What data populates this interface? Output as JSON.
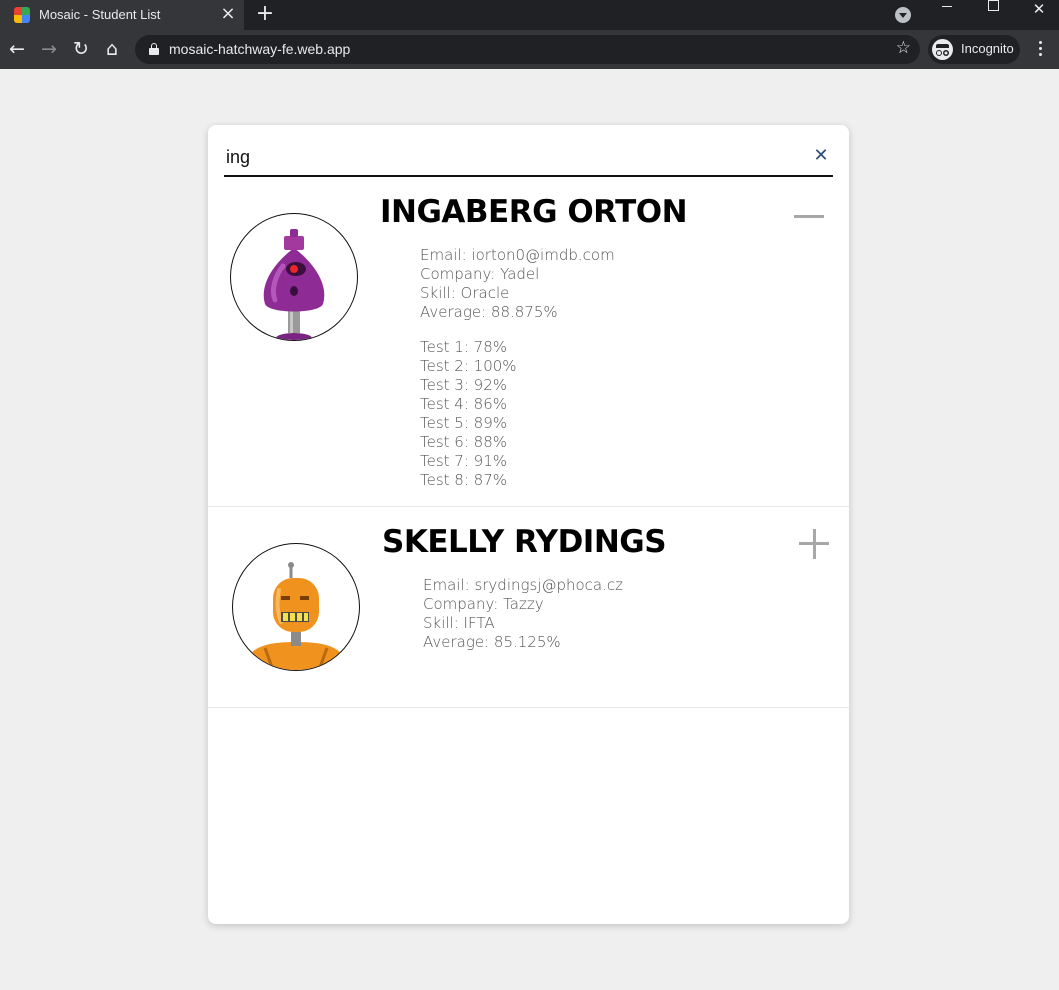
{
  "browser": {
    "tab_title": "Mosaic - Student List",
    "url": "mosaic-hatchway-fe.web.app",
    "profile_label": "Incognito"
  },
  "search": {
    "value": "ing"
  },
  "students": [
    {
      "name": "INGABERG ORTON",
      "email": "Email: iorton0@imdb.com",
      "company": "Company: Yadel",
      "skill": "Skill: Oracle",
      "average": "Average: 88.875%",
      "expanded": true,
      "avatar_color": "#8e2b95",
      "grades": [
        "Test 1: 78%",
        "Test 2: 100%",
        "Test 3: 92%",
        "Test 4: 86%",
        "Test 5: 89%",
        "Test 6: 88%",
        "Test 7: 91%",
        "Test 8: 87%"
      ]
    },
    {
      "name": "SKELLY RYDINGS",
      "email": "Email: srydingsj@phoca.cz",
      "company": "Company: Tazzy",
      "skill": "Skill: IFTA",
      "average": "Average: 85.125%",
      "expanded": false,
      "avatar_color": "#f0921e"
    }
  ],
  "colors": {
    "accent": "#2e4a7a",
    "toggle": "#a8a8a8",
    "page_bg": "#efefef"
  },
  "icons": [
    "back-arrow-icon",
    "forward-arrow-icon",
    "reload-icon",
    "home-icon",
    "lock-icon",
    "star-icon",
    "incognito-icon",
    "menu-icon",
    "clear-icon",
    "collapse-icon",
    "expand-icon"
  ]
}
